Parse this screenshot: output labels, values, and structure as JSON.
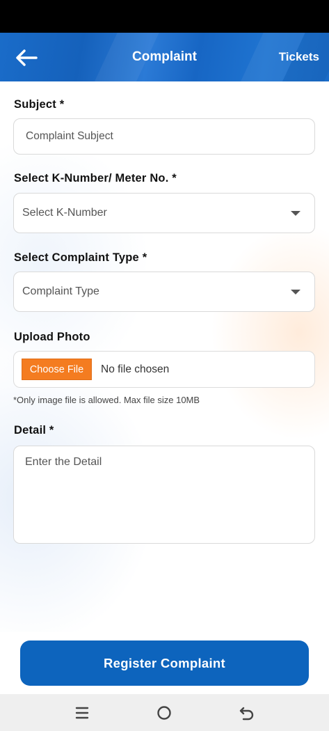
{
  "header": {
    "title": "Complaint",
    "right_link": "Tickets",
    "back_icon": "arrow-left-icon"
  },
  "form": {
    "subject": {
      "label": "Subject *",
      "placeholder": "Complaint Subject"
    },
    "k_number": {
      "label": "Select K-Number/ Meter No. *",
      "selected": "Select K-Number"
    },
    "complaint_type": {
      "label": "Select Complaint Type *",
      "selected": "Complaint Type"
    },
    "upload": {
      "label": "Upload Photo",
      "button_label": "Choose File",
      "status": "No file chosen",
      "hint": "*Only image file is allowed. Max file size 10MB"
    },
    "detail": {
      "label": "Detail *",
      "placeholder": "Enter the Detail"
    }
  },
  "footer": {
    "submit_label": "Register Complaint"
  },
  "system_nav": {
    "icons": [
      "menu-icon",
      "home-circle-icon",
      "back-icon"
    ]
  },
  "colors": {
    "header_blue": "#1a6cc9",
    "button_blue": "#0d64bd",
    "accent_orange": "#f47c20"
  }
}
